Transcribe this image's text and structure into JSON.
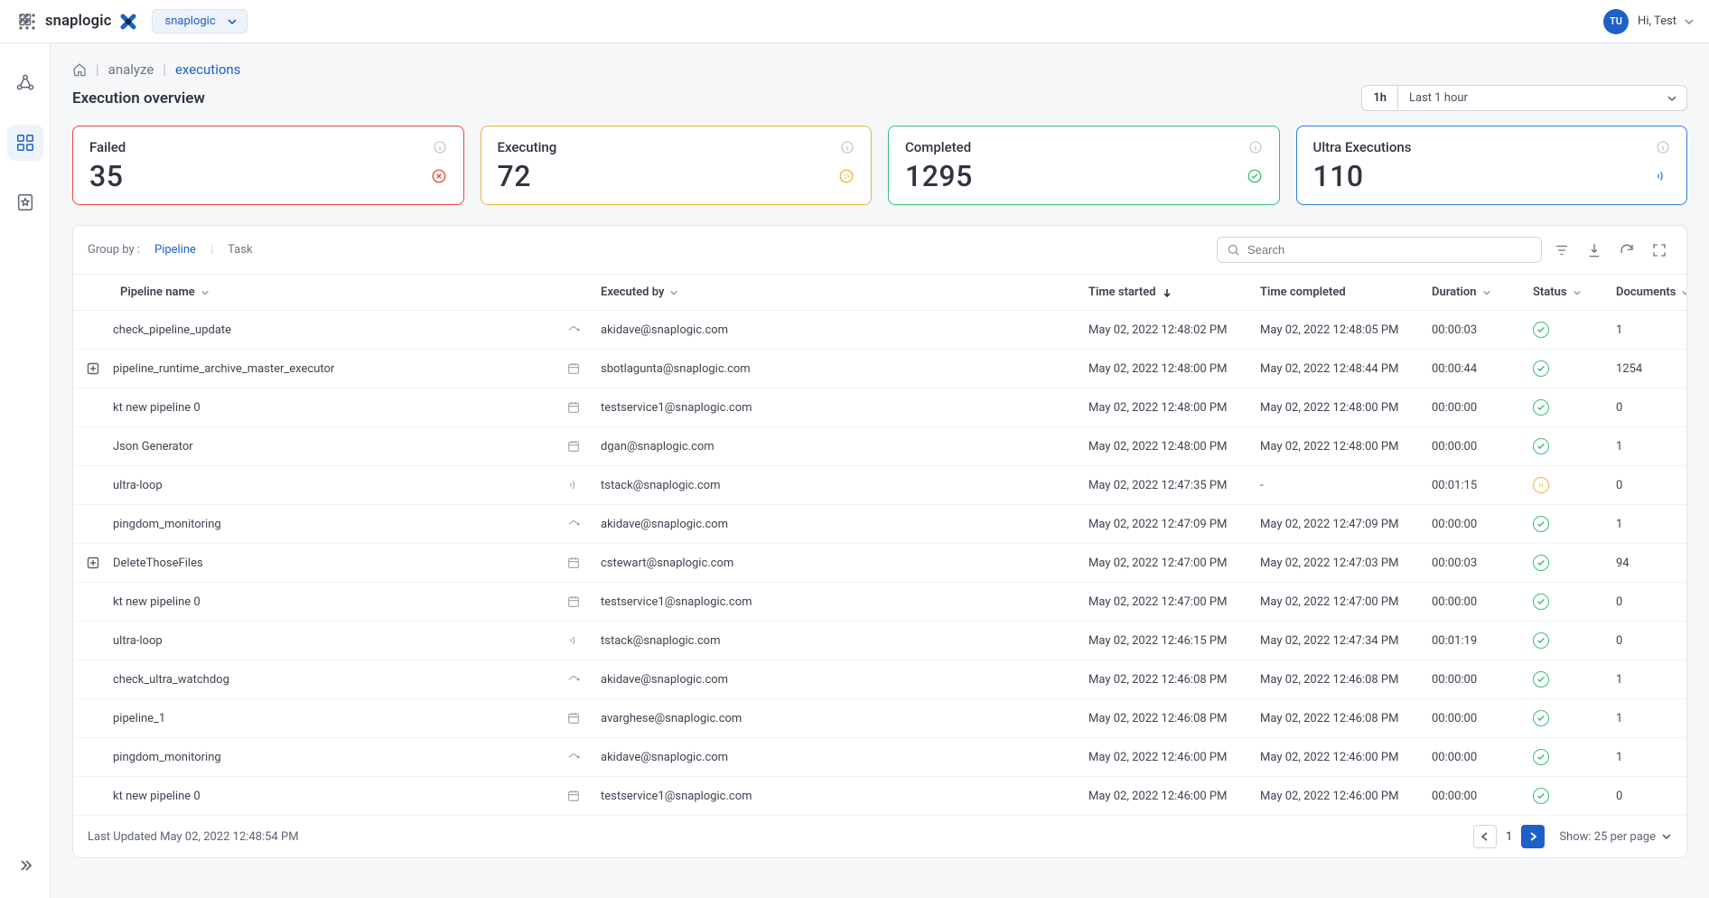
{
  "header": {
    "brand": "snaplogic",
    "org_selected": "snaplogic",
    "user_initials": "TU",
    "greeting": "Hi, Test"
  },
  "breadcrumb": {
    "analyze": "analyze",
    "executions": "executions"
  },
  "page_title": "Execution overview",
  "time_range": {
    "chip": "1h",
    "label": "Last 1 hour"
  },
  "cards": {
    "failed": {
      "title": "Failed",
      "value": "35"
    },
    "executing": {
      "title": "Executing",
      "value": "72"
    },
    "completed": {
      "title": "Completed",
      "value": "1295"
    },
    "ultra": {
      "title": "Ultra Executions",
      "value": "110"
    }
  },
  "groupby": {
    "label": "Group by :",
    "pipeline": "Pipeline",
    "task": "Task"
  },
  "search": {
    "placeholder": "Search"
  },
  "columns": {
    "pipeline_name": "Pipeline name",
    "executed_by": "Executed by",
    "time_started": "Time started",
    "time_completed": "Time completed",
    "duration": "Duration",
    "status": "Status",
    "documents": "Documents"
  },
  "rows": [
    {
      "expand": false,
      "name": "check_pipeline_update",
      "kind": "triggered",
      "by": "akidave@snaplogic.com",
      "started": "May 02, 2022 12:48:02 PM",
      "completed": "May 02, 2022 12:48:05 PM",
      "duration": "00:00:03",
      "status": "completed",
      "docs": "1"
    },
    {
      "expand": true,
      "name": "pipeline_runtime_archive_master_executor",
      "kind": "scheduled",
      "by": "sbotlagunta@snaplogic.com",
      "started": "May 02, 2022 12:48:00 PM",
      "completed": "May 02, 2022 12:48:44 PM",
      "duration": "00:00:44",
      "status": "completed",
      "docs": "1254"
    },
    {
      "expand": false,
      "name": "kt new pipeline 0",
      "kind": "scheduled",
      "by": "testservice1@snaplogic.com",
      "started": "May 02, 2022 12:48:00 PM",
      "completed": "May 02, 2022 12:48:00 PM",
      "duration": "00:00:00",
      "status": "completed",
      "docs": "0"
    },
    {
      "expand": false,
      "name": "Json Generator",
      "kind": "scheduled",
      "by": "dgan@snaplogic.com",
      "started": "May 02, 2022 12:48:00 PM",
      "completed": "May 02, 2022 12:48:00 PM",
      "duration": "00:00:00",
      "status": "completed",
      "docs": "1"
    },
    {
      "expand": false,
      "name": "ultra-loop",
      "kind": "ultra",
      "by": "tstack@snaplogic.com",
      "started": "May 02, 2022 12:47:35 PM",
      "completed": "-",
      "duration": "00:01:15",
      "status": "running",
      "docs": "0"
    },
    {
      "expand": false,
      "name": "pingdom_monitoring",
      "kind": "triggered",
      "by": "akidave@snaplogic.com",
      "started": "May 02, 2022 12:47:09 PM",
      "completed": "May 02, 2022 12:47:09 PM",
      "duration": "00:00:00",
      "status": "completed",
      "docs": "1"
    },
    {
      "expand": true,
      "name": "DeleteThoseFiles",
      "kind": "scheduled",
      "by": "cstewart@snaplogic.com",
      "started": "May 02, 2022 12:47:00 PM",
      "completed": "May 02, 2022 12:47:03 PM",
      "duration": "00:00:03",
      "status": "completed",
      "docs": "94"
    },
    {
      "expand": false,
      "name": "kt new pipeline 0",
      "kind": "scheduled",
      "by": "testservice1@snaplogic.com",
      "started": "May 02, 2022 12:47:00 PM",
      "completed": "May 02, 2022 12:47:00 PM",
      "duration": "00:00:00",
      "status": "completed",
      "docs": "0"
    },
    {
      "expand": false,
      "name": "ultra-loop",
      "kind": "ultra",
      "by": "tstack@snaplogic.com",
      "started": "May 02, 2022 12:46:15 PM",
      "completed": "May 02, 2022 12:47:34 PM",
      "duration": "00:01:19",
      "status": "completed",
      "docs": "0"
    },
    {
      "expand": false,
      "name": "check_ultra_watchdog",
      "kind": "triggered",
      "by": "akidave@snaplogic.com",
      "started": "May 02, 2022 12:46:08 PM",
      "completed": "May 02, 2022 12:46:08 PM",
      "duration": "00:00:00",
      "status": "completed",
      "docs": "1"
    },
    {
      "expand": false,
      "name": "pipeline_1",
      "kind": "scheduled",
      "by": "avarghese@snaplogic.com",
      "started": "May 02, 2022 12:46:08 PM",
      "completed": "May 02, 2022 12:46:08 PM",
      "duration": "00:00:00",
      "status": "completed",
      "docs": "1"
    },
    {
      "expand": false,
      "name": "pingdom_monitoring",
      "kind": "triggered",
      "by": "akidave@snaplogic.com",
      "started": "May 02, 2022 12:46:00 PM",
      "completed": "May 02, 2022 12:46:00 PM",
      "duration": "00:00:00",
      "status": "completed",
      "docs": "1"
    },
    {
      "expand": false,
      "name": "kt new pipeline 0",
      "kind": "scheduled",
      "by": "testservice1@snaplogic.com",
      "started": "May 02, 2022 12:46:00 PM",
      "completed": "May 02, 2022 12:46:00 PM",
      "duration": "00:00:00",
      "status": "completed",
      "docs": "0"
    }
  ],
  "footer": {
    "last_updated": "Last Updated May 02, 2022 12:48:54 PM",
    "page": "1",
    "per_page_label": "Show: 25 per page"
  }
}
